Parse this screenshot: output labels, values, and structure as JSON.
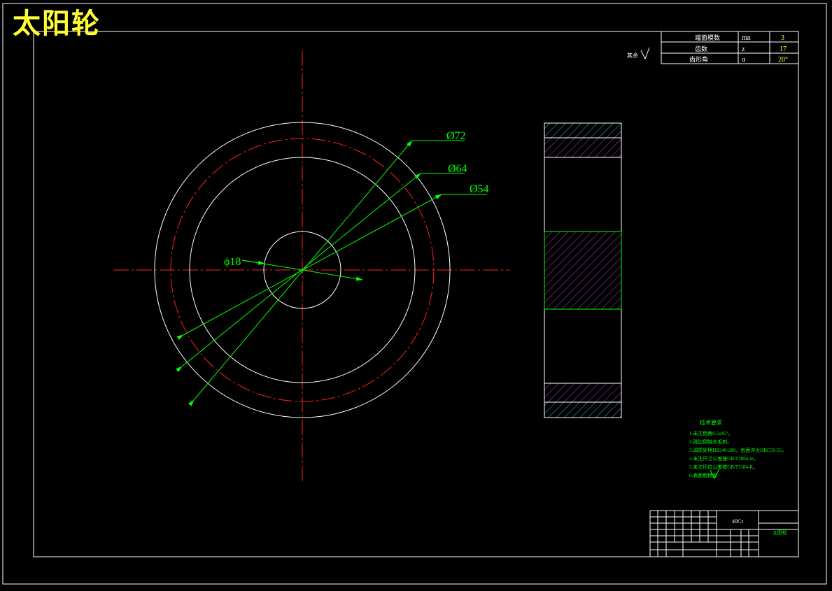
{
  "drawing": {
    "title": "太阳轮",
    "surface_note": "其余",
    "dimensions": {
      "d72": "Ø72",
      "d64": "Ø64",
      "d54": "Ø54",
      "d18": "ϕ18"
    },
    "params": [
      {
        "name": "端面模数",
        "sym": "mn",
        "val": "3"
      },
      {
        "name": "齿数",
        "sym": "z",
        "val": "17"
      },
      {
        "name": "齿形角",
        "sym": "α",
        "val": "20°"
      }
    ],
    "tech_req": {
      "title": "技术要求",
      "items": [
        "1.未注倒角0.5x45°。",
        "2.锐边倒钝去毛刺。",
        "3.调质处理HB240-280，齿面淬火HRC50-55。",
        "4.未注尺寸公差按GB/T1804-m。",
        "5.未注形位公差按GB/T1184-K。",
        "6.表面粗糙度"
      ]
    },
    "title_block": {
      "material": "40Cr",
      "name": "太阳轮"
    },
    "colors": {
      "outline": "#ffffff",
      "centerline": "#ff2020",
      "dimension": "#00ff00",
      "hatch_purple": "#b040d0",
      "hatch_cyan": "#40c0c0",
      "title": "#ffff33"
    }
  }
}
